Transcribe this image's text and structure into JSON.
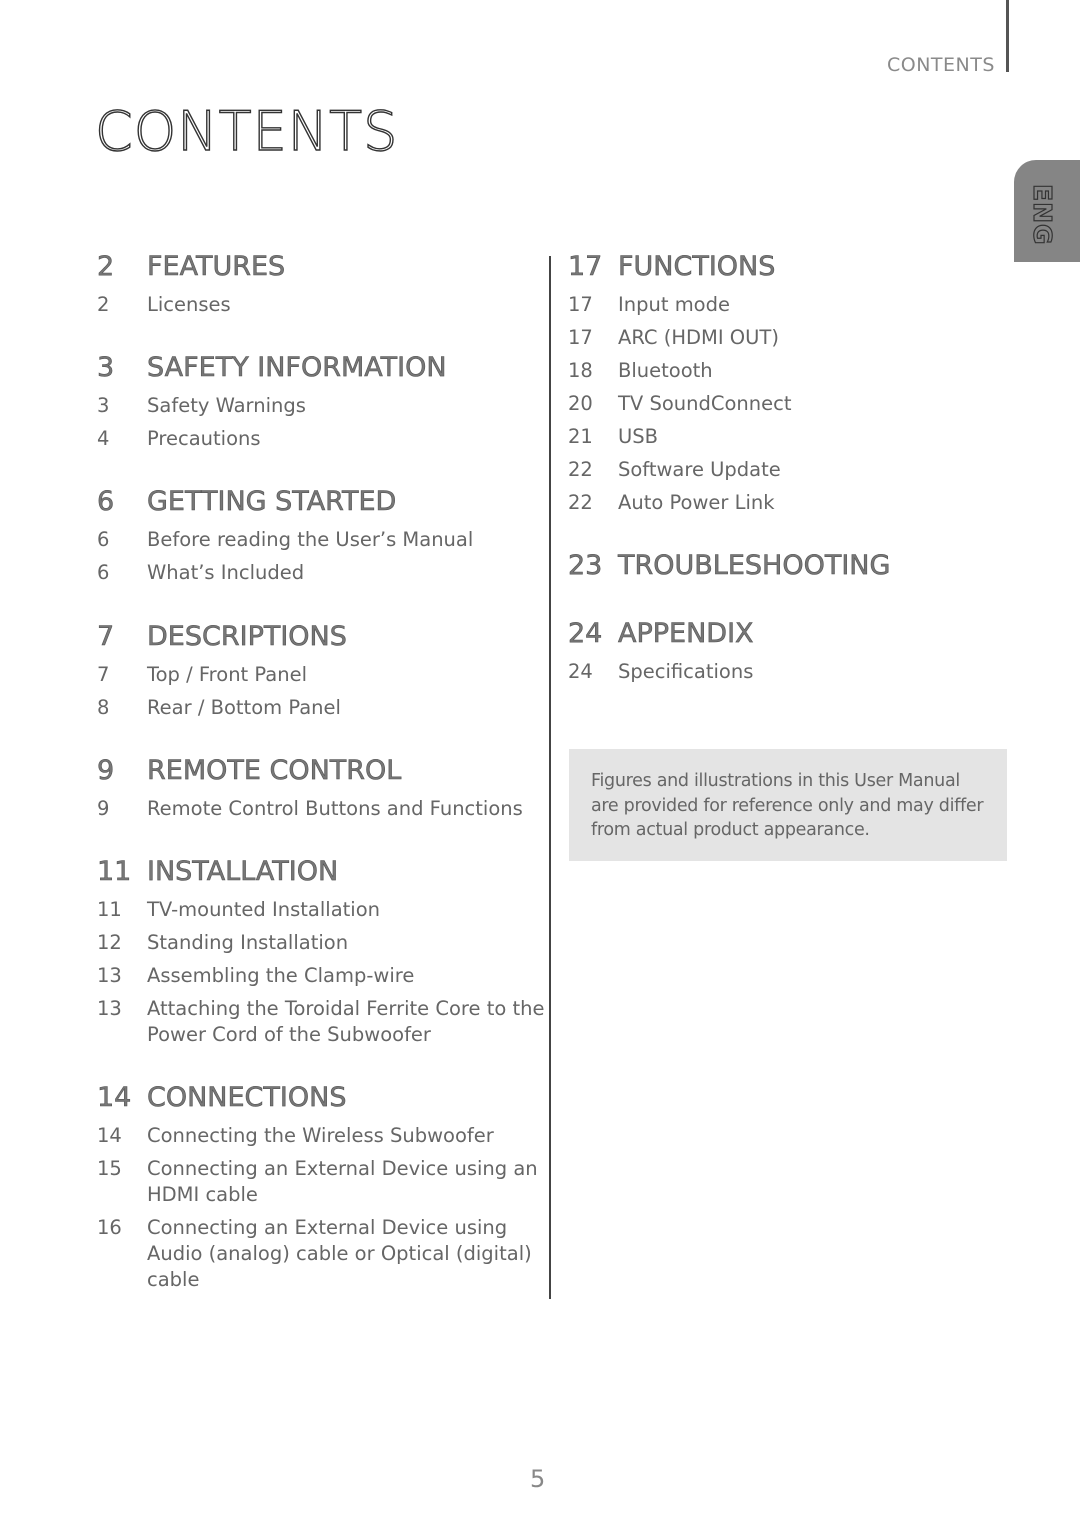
{
  "header": {
    "section_label": "CONTENTS",
    "title": "CONTENTS",
    "language_tab": "ENG"
  },
  "left_column": [
    {
      "page": "2",
      "title": "FEATURES",
      "items": [
        {
          "page": "2",
          "text": "Licenses"
        }
      ]
    },
    {
      "page": "3",
      "title": "SAFETY INFORMATION",
      "items": [
        {
          "page": "3",
          "text": "Safety Warnings"
        },
        {
          "page": "4",
          "text": "Precautions"
        }
      ]
    },
    {
      "page": "6",
      "title": "GETTING STARTED",
      "items": [
        {
          "page": "6",
          "text": "Before reading the User’s Manual"
        },
        {
          "page": "6",
          "text": "What’s Included"
        }
      ]
    },
    {
      "page": "7",
      "title": "DESCRIPTIONS",
      "items": [
        {
          "page": "7",
          "text": "Top / Front Panel"
        },
        {
          "page": "8",
          "text": "Rear / Bottom Panel"
        }
      ]
    },
    {
      "page": "9",
      "title": "REMOTE CONTROL",
      "items": [
        {
          "page": "9",
          "text": "Remote Control Buttons and Functions"
        }
      ]
    },
    {
      "page": "11",
      "title": "INSTALLATION",
      "items": [
        {
          "page": "11",
          "text": "TV-mounted Installation"
        },
        {
          "page": "12",
          "text": "Standing Installation"
        },
        {
          "page": "13",
          "text": "Assembling the Clamp-wire"
        },
        {
          "page": "13",
          "text": "Attaching the Toroidal Ferrite Core to the Power Cord of the Subwoofer"
        }
      ]
    },
    {
      "page": "14",
      "title": "CONNECTIONS",
      "items": [
        {
          "page": "14",
          "text": "Connecting the Wireless Subwoofer"
        },
        {
          "page": "15",
          "text": "Connecting an External Device using an HDMI cable"
        },
        {
          "page": "16",
          "text": "Connecting an External Device using Audio (analog) cable or Optical (digital) cable"
        }
      ]
    }
  ],
  "right_column": [
    {
      "page": "17",
      "title": "FUNCTIONS",
      "items": [
        {
          "page": "17",
          "text": "Input mode"
        },
        {
          "page": "17",
          "text": "ARC (HDMI OUT)"
        },
        {
          "page": "18",
          "text": "Bluetooth"
        },
        {
          "page": "20",
          "text": "TV SoundConnect"
        },
        {
          "page": "21",
          "text": "USB"
        },
        {
          "page": "22",
          "text": "Software Update"
        },
        {
          "page": "22",
          "text": "Auto Power Link"
        }
      ]
    },
    {
      "page": "23",
      "title": "TROUBLESHOOTING",
      "items": []
    },
    {
      "page": "24",
      "title": "APPENDIX",
      "items": [
        {
          "page": "24",
          "text": "Specifications"
        }
      ]
    }
  ],
  "note": "Figures and illustrations in this User Manual are provided for reference only and may differ from actual product appearance.",
  "page_number": "5"
}
